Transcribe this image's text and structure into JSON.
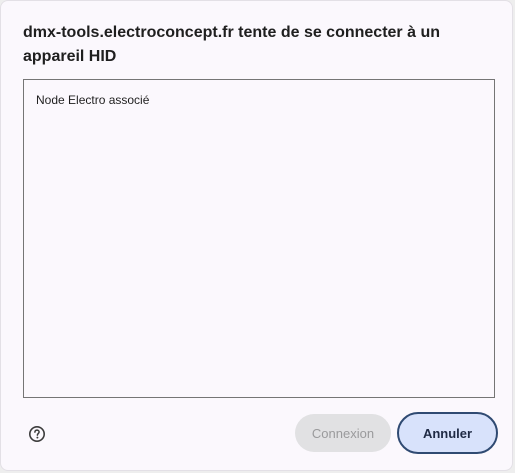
{
  "dialog": {
    "title": "dmx-tools.electroconcept.fr tente de se connecter à un appareil HID",
    "devices": [
      {
        "label": "Node Electro associé"
      }
    ],
    "help_icon": "question-circle-icon",
    "buttons": {
      "connect_label": "Connexion",
      "connect_enabled": false,
      "cancel_label": "Annuler"
    }
  }
}
